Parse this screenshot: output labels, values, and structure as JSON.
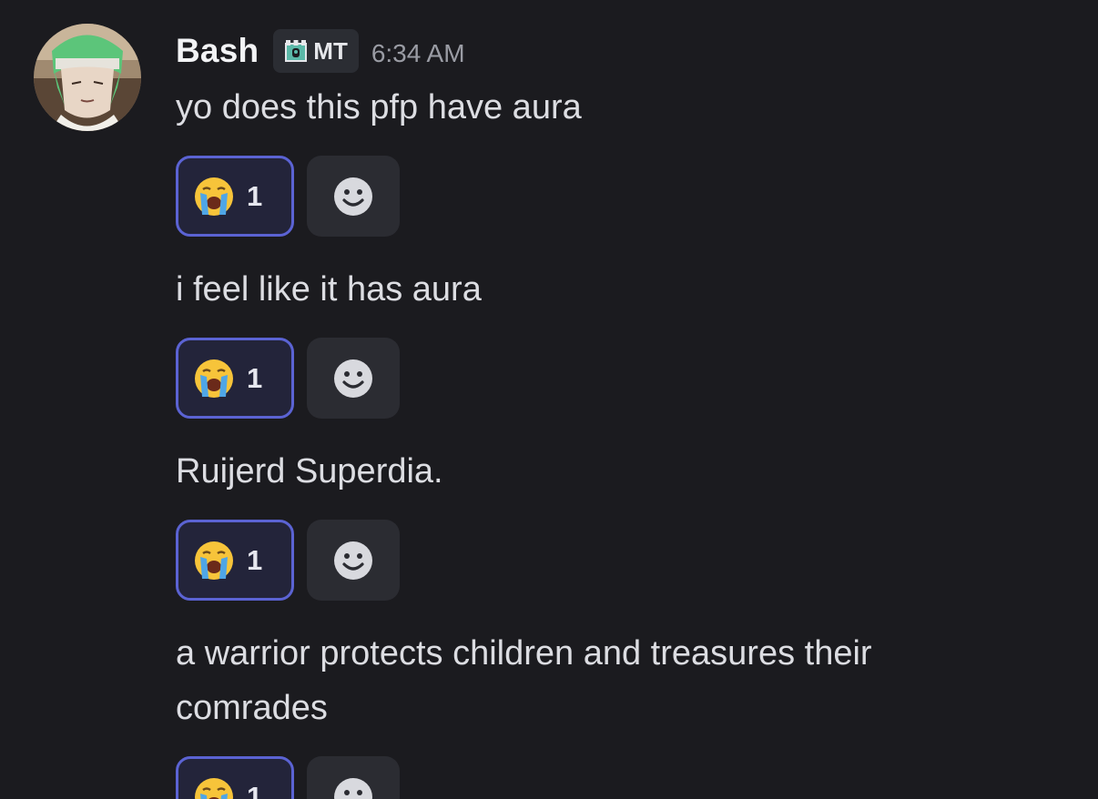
{
  "author": {
    "name": "Bash",
    "tag": "MT",
    "timestamp": "6:34 AM"
  },
  "messages": [
    {
      "text": "yo does this pfp have aura",
      "reaction_emoji": "crying-face",
      "reaction_count": "1"
    },
    {
      "text": "i feel like it has aura",
      "reaction_emoji": "crying-face",
      "reaction_count": "1"
    },
    {
      "text": "Ruijerd Superdia.",
      "reaction_emoji": "crying-face",
      "reaction_count": "1"
    },
    {
      "text": "a warrior protects children and treasures their comrades",
      "reaction_emoji": "crying-face",
      "reaction_count": "1"
    }
  ],
  "colors": {
    "background": "#1b1b1f",
    "reaction_border": "#5b63d3",
    "reaction_bg": "#23243a"
  }
}
